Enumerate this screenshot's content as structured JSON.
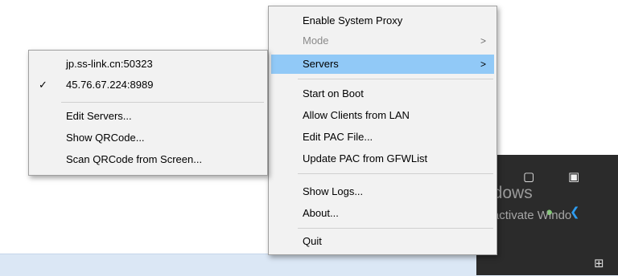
{
  "main_menu": {
    "items": [
      {
        "label": "Enable System Proxy"
      },
      {
        "label": "Mode"
      },
      {
        "label": "Servers"
      },
      {
        "label": "Start on Boot"
      },
      {
        "label": "Allow Clients from LAN"
      },
      {
        "label": "Edit PAC File..."
      },
      {
        "label": "Update PAC from GFWList"
      },
      {
        "label": "Show Logs..."
      },
      {
        "label": "About..."
      },
      {
        "label": "Quit"
      }
    ],
    "submenu_arrow": ">"
  },
  "servers_menu": {
    "items": [
      {
        "label": "jp.ss-link.cn:50323"
      },
      {
        "label": "45.76.67.224:8989"
      },
      {
        "label": "Edit Servers..."
      },
      {
        "label": "Show QRCode..."
      },
      {
        "label": "Scan QRCode from Screen..."
      }
    ],
    "checkmark": "✓"
  },
  "watermark": {
    "title": "Activate Windows",
    "subtitle": "Go to Settings to activate Windo"
  },
  "colors": {
    "menu_bg": "#f2f2f2",
    "highlight": "#91c9f7",
    "disabled_text": "#8a8a8a",
    "taskbar": "#dbe7f5",
    "tray_dark": "#2b2b2b"
  }
}
